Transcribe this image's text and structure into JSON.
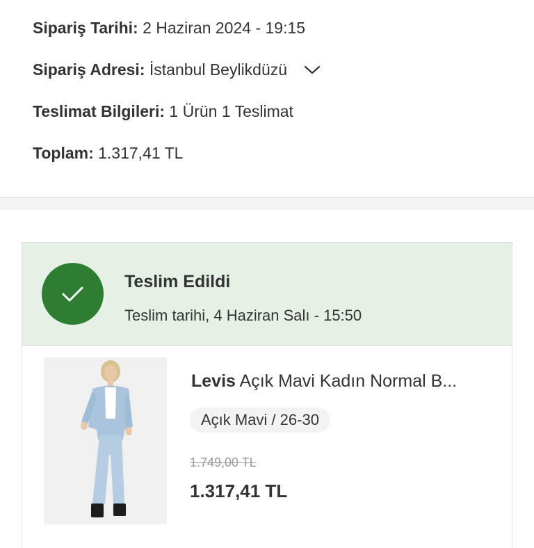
{
  "order": {
    "date_label": "Sipariş Tarihi:",
    "date_value": "2 Haziran 2024 - 19:15",
    "address_label": "Sipariş Adresi:",
    "address_value": "İstanbul Beylikdüzü",
    "delivery_label": "Teslimat Bilgileri:",
    "delivery_value": "1 Ürün 1 Teslimat",
    "total_label": "Toplam:",
    "total_value": "1.317,41 TL"
  },
  "shipment": {
    "status_title": "Teslim Edildi",
    "status_detail": "Teslim tarihi, 4 Haziran Salı - 15:50",
    "status_color": "#2e7d32",
    "status_bg": "#e6f1e6",
    "product": {
      "brand": "Levis",
      "name": "Açık Mavi Kadın Normal B...",
      "variant": "Açık Mavi / 26-30",
      "old_price": "1.749,00 TL",
      "price": "1.317,41 TL"
    }
  },
  "icons": {
    "address_toggle": "chevron-down-icon",
    "status": "check-icon"
  }
}
